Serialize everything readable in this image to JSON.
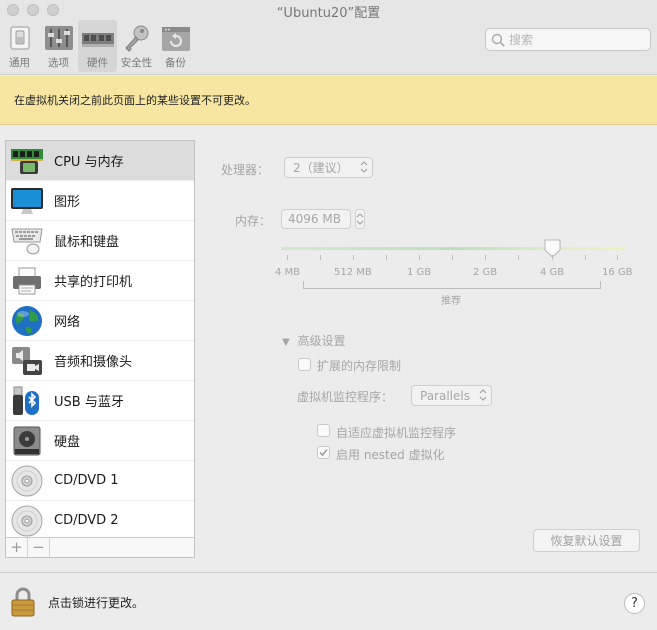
{
  "window": {
    "title": "“Ubuntu20”配置"
  },
  "toolbar": {
    "items": [
      {
        "label": "通用",
        "icon": "general-switch-icon"
      },
      {
        "label": "选项",
        "icon": "options-sliders-icon"
      },
      {
        "label": "硬件",
        "icon": "hardware-ram-icon",
        "active": true
      },
      {
        "label": "安全性",
        "icon": "security-key-icon"
      },
      {
        "label": "备份",
        "icon": "backup-icon"
      }
    ],
    "search_placeholder": "搜索"
  },
  "banner": {
    "text": "在虚拟机关闭之前此页面上的某些设置不可更改。"
  },
  "sidebar": {
    "items": [
      {
        "label": "CPU 与内存",
        "icon": "cpu-memory-icon",
        "selected": true
      },
      {
        "label": "图形",
        "icon": "display-icon"
      },
      {
        "label": "鼠标和键盘",
        "icon": "mouse-keyboard-icon"
      },
      {
        "label": "共享的打印机",
        "icon": "printer-icon"
      },
      {
        "label": "网络",
        "icon": "network-globe-icon"
      },
      {
        "label": "音频和摄像头",
        "icon": "audio-camera-icon"
      },
      {
        "label": "USB 与蓝牙",
        "icon": "usb-bluetooth-icon"
      },
      {
        "label": "硬盘",
        "icon": "hard-disk-icon"
      },
      {
        "label": "CD/DVD 1",
        "icon": "cd-dvd-icon"
      },
      {
        "label": "CD/DVD 2",
        "icon": "cd-dvd-icon"
      }
    ],
    "add_label": "+",
    "remove_label": "−"
  },
  "cpu": {
    "label": "处理器：",
    "value": "2（建议）"
  },
  "memory": {
    "label": "内存：",
    "value": "4096 MB",
    "slider_ticks": [
      "4 MB",
      "512 MB",
      "1 GB",
      "2 GB",
      "4 GB",
      "16 GB"
    ],
    "recommended_label": "推荐"
  },
  "advanced": {
    "label": "高级设置",
    "extended_memory_label": "扩展的内存限制",
    "extended_memory_checked": false,
    "hypervisor_label": "虚拟机监控程序：",
    "hypervisor_value": "Parallels",
    "adaptive_label": "自适应虚拟机监控程序",
    "adaptive_checked": false,
    "nested_label": "启用 nested 虚拟化",
    "nested_checked": true
  },
  "restore_button": "恢复默认设置",
  "bottom": {
    "lock_text": "点击锁进行更改。",
    "help_label": "?"
  }
}
